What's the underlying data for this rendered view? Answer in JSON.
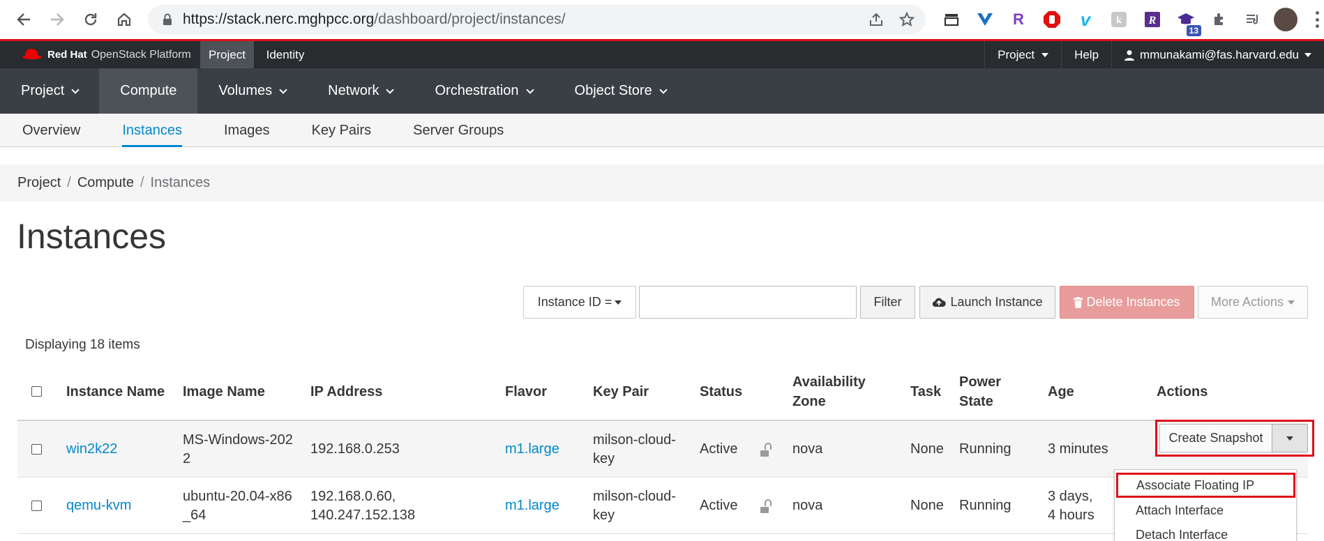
{
  "browser": {
    "url_host": "https://stack.nerc.mghpcc.org",
    "url_path": "/dashboard/project/instances/",
    "extension_badge": "13"
  },
  "topnav": {
    "brand_bold": "Red Hat",
    "brand_rest": "OpenStack Platform",
    "context_project": "Project",
    "context_identity": "Identity",
    "project_menu": "Project",
    "help": "Help",
    "user": "mmunakami@fas.harvard.edu"
  },
  "mainnav": [
    "Project",
    "Compute",
    "Volumes",
    "Network",
    "Orchestration",
    "Object Store"
  ],
  "subnav": [
    "Overview",
    "Instances",
    "Images",
    "Key Pairs",
    "Server Groups"
  ],
  "breadcrumb": [
    "Project",
    "Compute",
    "Instances"
  ],
  "page_title": "Instances",
  "toolbar": {
    "filter_field": "Instance ID =",
    "search_value": "",
    "filter": "Filter",
    "launch": "Launch Instance",
    "delete": "Delete Instances",
    "more": "More Actions"
  },
  "count": "Displaying 18 items",
  "table": {
    "headers": {
      "name": "Instance Name",
      "image": "Image Name",
      "ip": "IP Address",
      "flavor": "Flavor",
      "keypair": "Key Pair",
      "status": "Status",
      "az_1": "Availability",
      "az_2": "Zone",
      "task": "Task",
      "power_1": "Power",
      "power_2": "State",
      "age": "Age",
      "actions": "Actions"
    },
    "rows": [
      {
        "name": "win2k22",
        "image_1": "MS-Windows-202",
        "image_2": "2",
        "ip_1": "192.168.0.253",
        "ip_2": "",
        "flavor": "m1.large",
        "key_1": "milson-cloud-",
        "key_2": "key",
        "status": "Active",
        "az": "nova",
        "task": "None",
        "power": "Running",
        "age_1": "3 minutes",
        "age_2": "",
        "action": "Create Snapshot"
      },
      {
        "name": "qemu-kvm",
        "image_1": "ubuntu-20.04-x86",
        "image_2": "_64",
        "ip_1": "192.168.0.60,",
        "ip_2": "140.247.152.138",
        "flavor": "m1.large",
        "key_1": "milson-cloud-",
        "key_2": "key",
        "status": "Active",
        "az": "nova",
        "task": "None",
        "power": "Running",
        "age_1": "3 days,",
        "age_2": "4 hours",
        "action": ""
      }
    ]
  },
  "dropdown": [
    "Associate Floating IP",
    "Attach Interface",
    "Detach Interface"
  ]
}
